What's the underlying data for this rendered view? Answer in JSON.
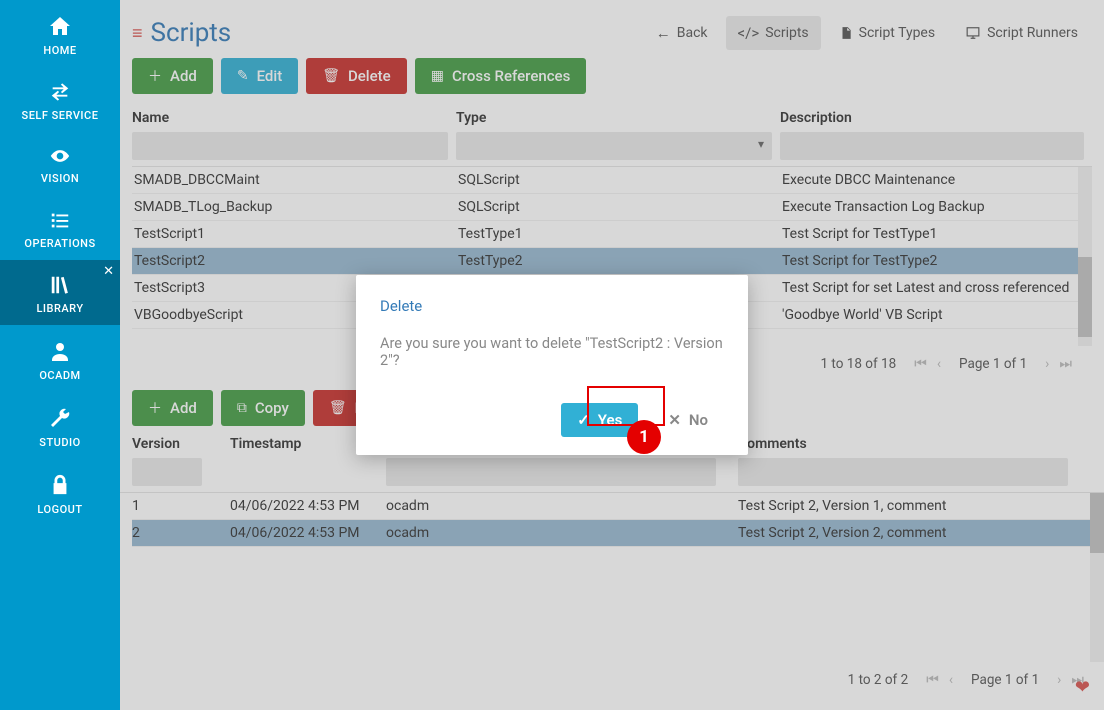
{
  "sidebar": {
    "items": [
      {
        "label": "HOME"
      },
      {
        "label": "SELF SERVICE"
      },
      {
        "label": "VISION"
      },
      {
        "label": "OPERATIONS"
      },
      {
        "label": "LIBRARY"
      },
      {
        "label": "OCADM"
      },
      {
        "label": "STUDIO"
      },
      {
        "label": "LOGOUT"
      }
    ]
  },
  "header": {
    "title": "Scripts",
    "nav": {
      "back": "Back",
      "scripts": "Scripts",
      "scriptTypes": "Script Types",
      "scriptRunners": "Script Runners"
    }
  },
  "toolbar": {
    "add": "Add",
    "edit": "Edit",
    "delete": "Delete",
    "cross": "Cross References"
  },
  "grid": {
    "cols": {
      "name": "Name",
      "type": "Type",
      "desc": "Description"
    },
    "rows": [
      {
        "name": "SMADB_DBCCMaint",
        "type": "SQLScript",
        "desc": "Execute DBCC Maintenance"
      },
      {
        "name": "SMADB_TLog_Backup",
        "type": "SQLScript",
        "desc": "Execute Transaction Log Backup"
      },
      {
        "name": "TestScript1",
        "type": "TestType1",
        "desc": "Test Script for TestType1"
      },
      {
        "name": "TestScript2",
        "type": "TestType2",
        "desc": "Test Script for TestType2"
      },
      {
        "name": "TestScript3",
        "type": "",
        "desc": "Test Script for set Latest and cross referenced"
      },
      {
        "name": "VBGoodbyeScript",
        "type": "",
        "desc": "'Goodbye World' VB Script"
      }
    ],
    "footer": {
      "range": "1 to 18 of 18",
      "page": "Page 1 of 1"
    }
  },
  "versions": {
    "toolbar": {
      "add": "Add",
      "copy": "Copy",
      "delete": "Del"
    },
    "cols": {
      "version": "Version",
      "timestamp": "Timestamp",
      "author": "ocadm",
      "comments": "Comments"
    },
    "rows": [
      {
        "version": "1",
        "timestamp": "04/06/2022 4:53 PM",
        "author": "ocadm",
        "comments": "Test Script 2, Version 1, comment"
      },
      {
        "version": "2",
        "timestamp": "04/06/2022 4:53 PM",
        "author": "ocadm",
        "comments": "Test Script 2, Version 2, comment"
      }
    ],
    "footer": {
      "range": "1 to 2 of 2",
      "page": "Page 1 of 1"
    }
  },
  "modal": {
    "title": "Delete",
    "message": "Are you sure you want to delete \"TestScript2 : Version 2\"?",
    "yes": "Yes",
    "no": "No"
  },
  "callout": {
    "n": "1"
  }
}
